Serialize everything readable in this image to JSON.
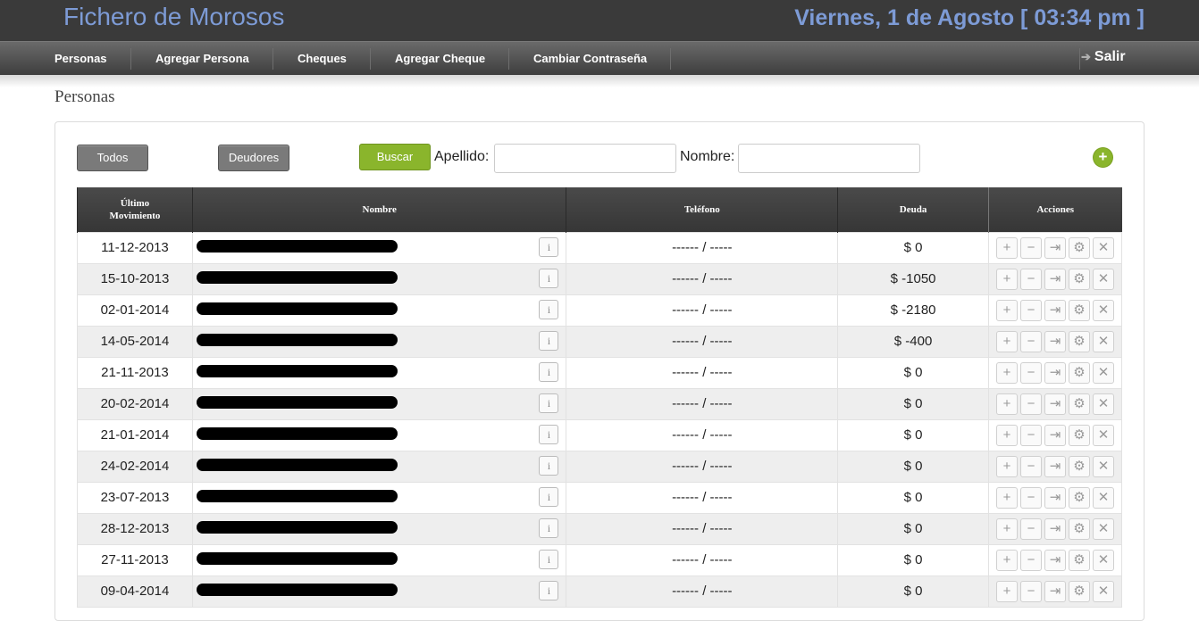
{
  "header": {
    "app_title": "Fichero de Morosos",
    "datetime": "Viernes, 1 de Agosto [ 03:34 pm ]"
  },
  "nav": {
    "items": [
      "Personas",
      "Agregar Persona",
      "Cheques",
      "Agregar Cheque",
      "Cambiar Contraseña"
    ],
    "logout_label": "Salir"
  },
  "page": {
    "title": "Personas"
  },
  "filters": {
    "todos_label": "Todos",
    "deudores_label": "Deudores",
    "buscar_label": "Buscar",
    "apellido_label": "Apellido:",
    "nombre_label": "Nombre:",
    "apellido_value": "",
    "nombre_value": ""
  },
  "table": {
    "headers": {
      "ultimo_line1": "Último",
      "ultimo_line2": "Movimiento",
      "nombre": "Nombre",
      "telefono": "Teléfono",
      "deuda": "Deuda",
      "acciones": "Acciones"
    },
    "rows": [
      {
        "date": "11-12-2013",
        "phone": "------ / -----",
        "debt": "$ 0",
        "debt_status": "ok"
      },
      {
        "date": "15-10-2013",
        "phone": "------ / -----",
        "debt": "$ -1050",
        "debt_status": "owed"
      },
      {
        "date": "02-01-2014",
        "phone": "------ / -----",
        "debt": "$ -2180",
        "debt_status": "owed"
      },
      {
        "date": "14-05-2014",
        "phone": "------ / -----",
        "debt": "$ -400",
        "debt_status": "owed"
      },
      {
        "date": "21-11-2013",
        "phone": "------ / -----",
        "debt": "$ 0",
        "debt_status": "ok"
      },
      {
        "date": "20-02-2014",
        "phone": "------ / -----",
        "debt": "$ 0",
        "debt_status": "ok"
      },
      {
        "date": "21-01-2014",
        "phone": "------ / -----",
        "debt": "$ 0",
        "debt_status": "ok"
      },
      {
        "date": "24-02-2014",
        "phone": "------ / -----",
        "debt": "$ 0",
        "debt_status": "ok"
      },
      {
        "date": "23-07-2013",
        "phone": "------ / -----",
        "debt": "$ 0",
        "debt_status": "ok"
      },
      {
        "date": "28-12-2013",
        "phone": "------ / -----",
        "debt": "$ 0",
        "debt_status": "ok"
      },
      {
        "date": "27-11-2013",
        "phone": "------ / -----",
        "debt": "$ 0",
        "debt_status": "ok"
      },
      {
        "date": "09-04-2014",
        "phone": "------ / -----",
        "debt": "$ 0",
        "debt_status": "ok"
      }
    ]
  },
  "colors": {
    "header_bg": "#3a3a3a",
    "title_blue": "#7d9bd6",
    "green": "#8ab52c",
    "debt_ok": "#2e9b2e",
    "debt_owed": "#e01b1b"
  }
}
